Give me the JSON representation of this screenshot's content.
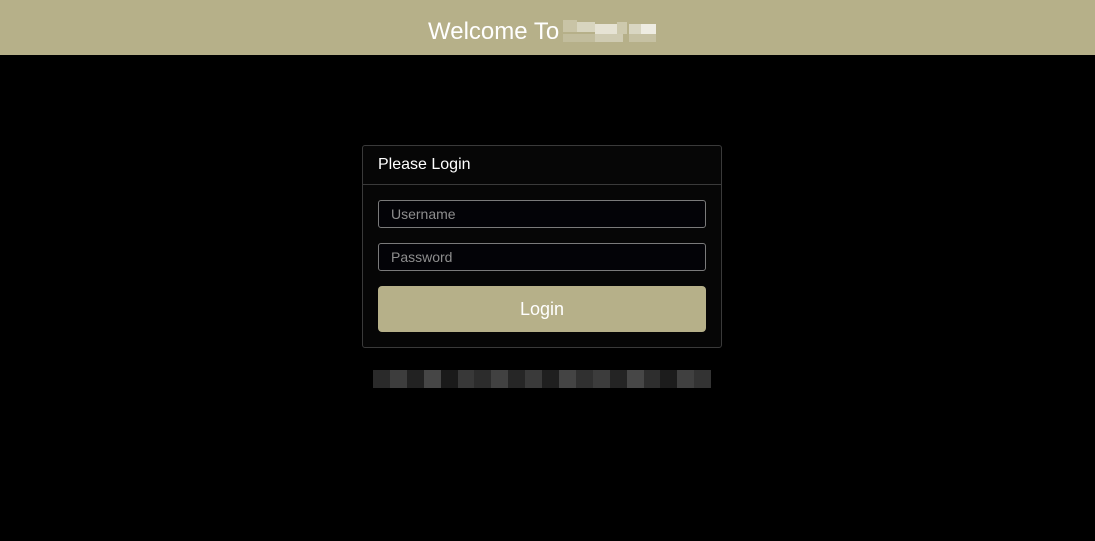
{
  "header": {
    "title": "Welcome To",
    "background_color": "#b6b089"
  },
  "login_panel": {
    "heading": "Please Login",
    "username": {
      "placeholder": "Username",
      "value": ""
    },
    "password": {
      "placeholder": "Password",
      "value": ""
    },
    "login_button_label": "Login",
    "accent_color": "#b6b089"
  }
}
